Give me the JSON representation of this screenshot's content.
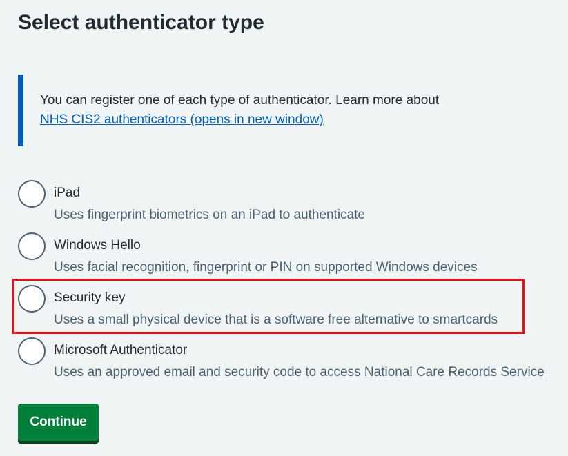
{
  "page": {
    "title": "Select authenticator type"
  },
  "inset": {
    "text": "You can register one of each type of authenticator. Learn more about",
    "link_text": "NHS CIS2 authenticators (opens in new window)"
  },
  "options": [
    {
      "label": "iPad",
      "hint": "Uses fingerprint biometrics on an iPad to authenticate",
      "selected": false
    },
    {
      "label": "Windows Hello",
      "hint": "Uses facial recognition, fingerprint or PIN on supported Windows devices",
      "selected": false
    },
    {
      "label": "Security key",
      "hint": "Uses a small physical device that is a software free alternative to smartcards",
      "selected": false,
      "highlighted": true
    },
    {
      "label": "Microsoft Authenticator",
      "hint": "Uses an approved email and security code to access National Care Records Service",
      "selected": false
    }
  ],
  "actions": {
    "continue_label": "Continue"
  },
  "colors": {
    "background": "#f0f4f5",
    "text": "#212b32",
    "link": "#005eb8",
    "inset_border": "#005eb8",
    "radio_border": "#4c6272",
    "hint_text": "#4c6272",
    "button": "#007f3b",
    "button_shadow": "#00401e",
    "highlight": "#e4121a"
  }
}
